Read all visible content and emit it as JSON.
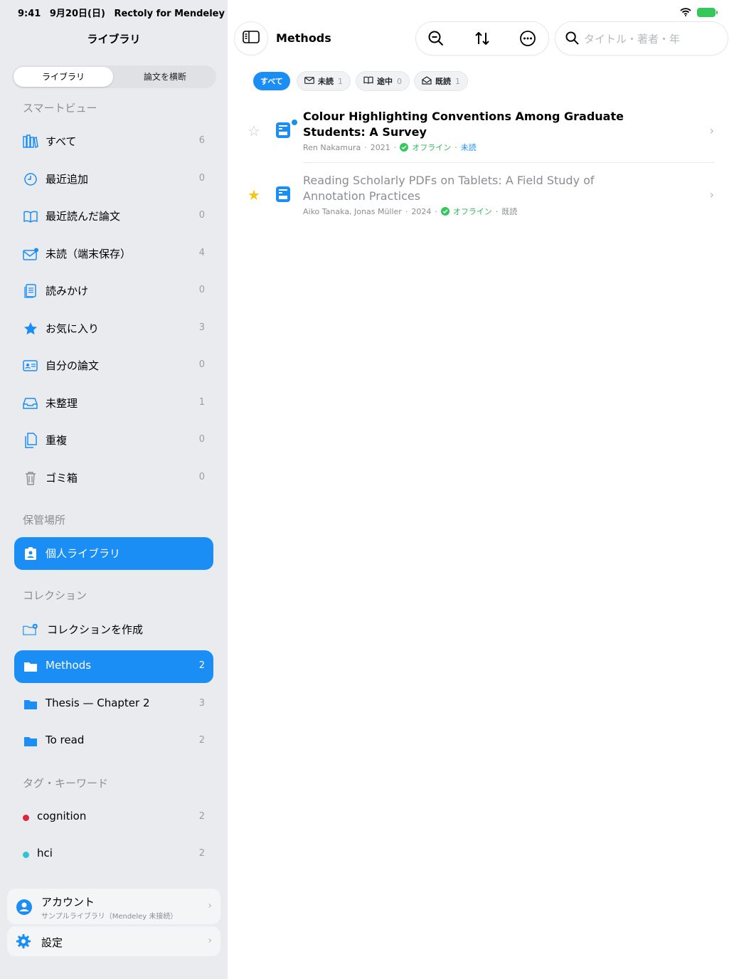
{
  "status": {
    "time": "9:41",
    "date": "9月20日(日)",
    "app": "Rectoly for Mendeley"
  },
  "sidebar": {
    "title": "ライブラリ",
    "segment": {
      "active": "ライブラリ",
      "inactive": "論文を横断"
    },
    "smart_header": "スマートビュー",
    "smart_items": [
      {
        "label": "すべて",
        "count": "6"
      },
      {
        "label": "最近追加",
        "count": "0"
      },
      {
        "label": "最近読んだ論文",
        "count": "0"
      },
      {
        "label": "未読（端末保存）",
        "count": "4"
      },
      {
        "label": "読みかけ",
        "count": "0"
      },
      {
        "label": "お気に入り",
        "count": "3"
      },
      {
        "label": "自分の論文",
        "count": "0"
      },
      {
        "label": "未整理",
        "count": "1"
      },
      {
        "label": "重複",
        "count": "0"
      },
      {
        "label": "ゴミ箱",
        "count": "0"
      }
    ],
    "storage_header": "保管場所",
    "storage_item": {
      "label": "個人ライブラリ"
    },
    "collections_header": "コレクション",
    "create_collection": "コレクションを作成",
    "collections": [
      {
        "label": "Methods",
        "count": "2"
      },
      {
        "label": "Thesis — Chapter 2",
        "count": "3"
      },
      {
        "label": "To read",
        "count": "2"
      }
    ],
    "tags_header": "タグ・キーワード",
    "tags": [
      {
        "label": "cognition",
        "count": "2",
        "color": "#e0243d"
      },
      {
        "label": "hci",
        "count": "2",
        "color": "#2ec4d6"
      }
    ],
    "account": {
      "title": "アカウント",
      "subtitle": "サンプルライブラリ（Mendeley 未接続）"
    },
    "settings": {
      "title": "設定"
    }
  },
  "main": {
    "title": "Methods",
    "search_placeholder": "タイトル・著者・年",
    "filters": [
      {
        "label": "すべて"
      },
      {
        "label": "未読",
        "count": "1"
      },
      {
        "label": "途中",
        "count": "0"
      },
      {
        "label": "既読",
        "count": "1"
      }
    ],
    "papers": [
      {
        "title": "Colour Highlighting Conventions Among Graduate Students: A Survey",
        "authors": "Ren Nakamura",
        "year": "2021",
        "offline": "オフライン",
        "status": "未読",
        "favorite": false
      },
      {
        "title": "Reading Scholarly PDFs on Tablets: A Field Study of Annotation Practices",
        "authors": "Aiko Tanaka, Jonas Müller",
        "year": "2024",
        "offline": "オフライン",
        "status": "既読",
        "favorite": true
      }
    ]
  },
  "colors": {
    "accent": "#1a8ef5",
    "sidebar_bg": "#e9ebee",
    "offline_green": "#34c759",
    "star": "#f5c518"
  }
}
